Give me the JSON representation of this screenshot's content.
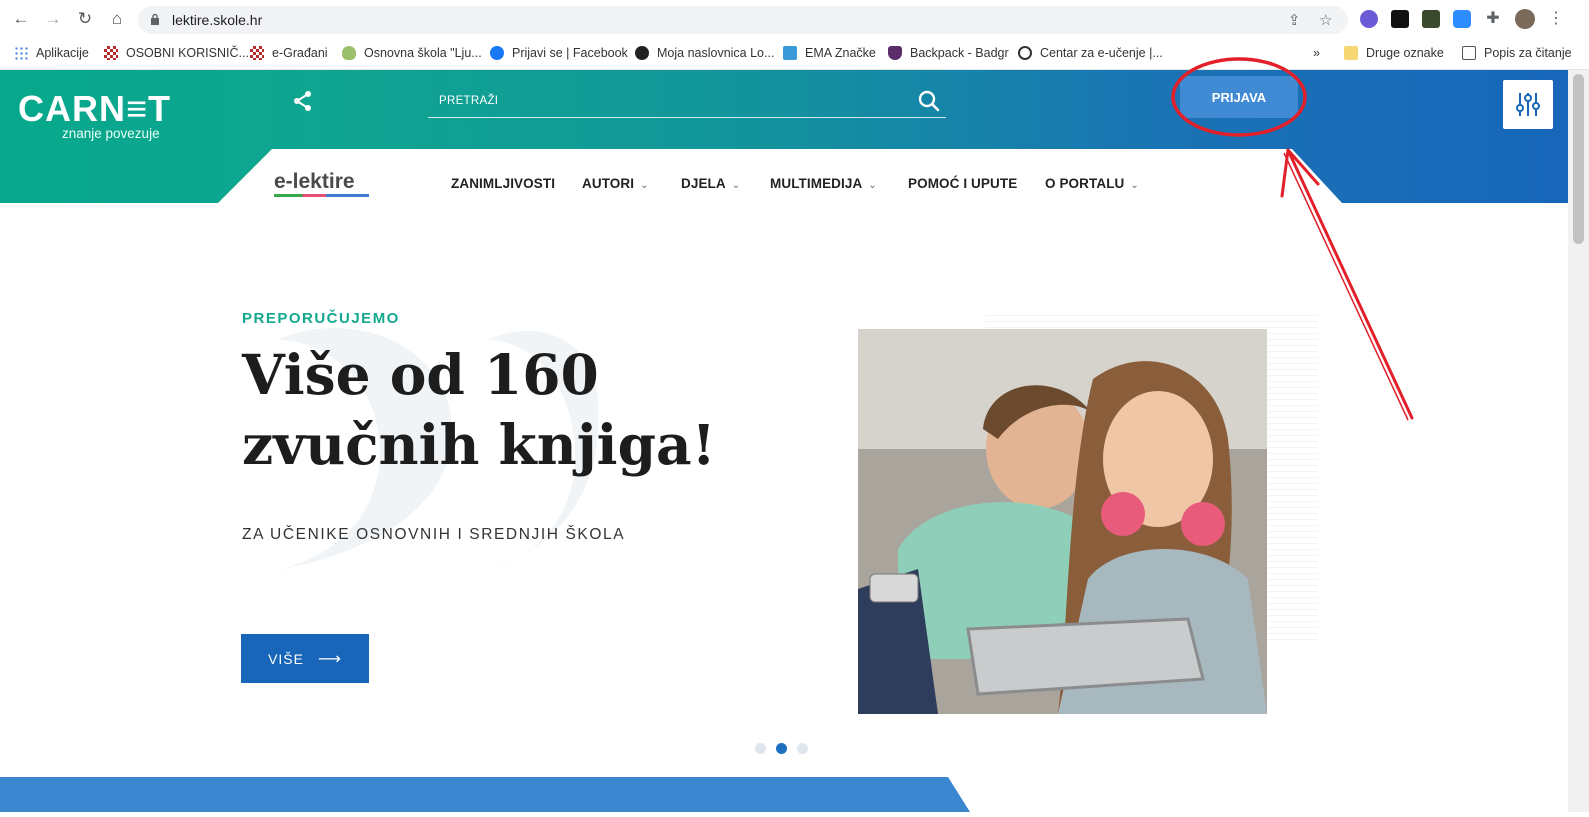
{
  "browser": {
    "url": "lektire.skole.hr",
    "bookmarks": [
      {
        "label": "Aplikacije"
      },
      {
        "label": "OSOBNI KORISNIČ..."
      },
      {
        "label": "e-Građani"
      },
      {
        "label": "Osnovna škola \"Lju..."
      },
      {
        "label": "Prijavi se | Facebook"
      },
      {
        "label": "Moja naslovnica Lo..."
      },
      {
        "label": "EMA Značke"
      },
      {
        "label": "Backpack - Badgr"
      },
      {
        "label": "Centar za e-učenje |..."
      },
      {
        "label": "»"
      },
      {
        "label": "Druge oznake"
      },
      {
        "label": "Popis za čitanje"
      }
    ]
  },
  "header": {
    "logo": "CARN≡T",
    "logo_tagline": "znanje povezuje",
    "search_placeholder": "PRETRAŽI",
    "login_label": "PRIJAVA",
    "brand": "e-lektire",
    "menu": [
      {
        "label": "ZANIMLJIVOSTI",
        "has_dropdown": false
      },
      {
        "label": "AUTORI",
        "has_dropdown": true
      },
      {
        "label": "DJELA",
        "has_dropdown": true
      },
      {
        "label": "MULTIMEDIJA",
        "has_dropdown": true
      },
      {
        "label": "POMOĆ I UPUTE",
        "has_dropdown": false
      },
      {
        "label": "O PORTALU",
        "has_dropdown": true
      }
    ],
    "chevron": "⌄"
  },
  "hero": {
    "kicker": "PREPORUČUJEMO",
    "headline_line1": "Više od 160",
    "headline_line2": "zvučnih knjiga!",
    "subline": "ZA UČENIKE OSNOVNIH I SREDNJIH ŠKOLA",
    "button_label": "VIŠE",
    "button_arrow": "⟶",
    "carousel_active_index": 1,
    "carousel_count": 3
  },
  "colors": {
    "teal": "#07a88c",
    "blue": "#1766ba",
    "annotation_red": "#e3202a"
  }
}
